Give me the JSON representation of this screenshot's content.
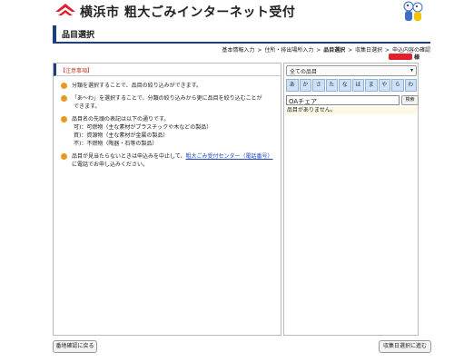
{
  "header": {
    "site_title": "横浜市 粗大ごみインターネット受付"
  },
  "page": {
    "title": "品目選択"
  },
  "breadcrumb": [
    {
      "label": "基本情報入力"
    },
    {
      "label": "住所・排出場所入力"
    },
    {
      "label": "品目選択"
    },
    {
      "label": "収集日選択"
    },
    {
      "label": "申込内容の確認"
    }
  ],
  "breadcrumb_sep": ">",
  "user": {
    "suffix": "様"
  },
  "notice": {
    "header": "【注意事項】",
    "items": [
      {
        "lines": [
          "分類を選択することで、品目の絞り込みができます。"
        ]
      },
      {
        "lines": [
          "「あ～わ」を選択することで、分類の絞り込みから更に品目を絞り込むことが",
          "できます。"
        ]
      },
      {
        "lines": [
          "品目名の先頭の表記は以下の通りです。",
          "可)：可燃物（主な素材がプラスチックや木などの製品）",
          "資)：資源物（主な素材が金属の製品）",
          "不)：不燃物（陶器・石等の製品）"
        ]
      },
      {
        "before_link": "品目が見当たらないときは申込みを中止して、",
        "link": "粗大ごみ受付センター（電話番号）",
        "after_link": "に電話でお申し込みください。"
      }
    ]
  },
  "category_select": {
    "value": "全ての品目"
  },
  "kana": [
    "あ",
    "か",
    "さ",
    "た",
    "な",
    "は",
    "ま",
    "や",
    "ら",
    "わ"
  ],
  "search": {
    "value": "OAチェア",
    "button_label": "検索"
  },
  "results": {
    "message": "品目がありません。"
  },
  "footer": {
    "back_label": "番地確認に戻る",
    "next_label": "収集日選択に進む"
  },
  "colors": {
    "accent_navy": "#1f3f7a",
    "brand_red": "#e0202a",
    "kana_bg": "#cfe1f5",
    "bullet_orange": "#e89a20",
    "link_blue": "#2244bb"
  }
}
